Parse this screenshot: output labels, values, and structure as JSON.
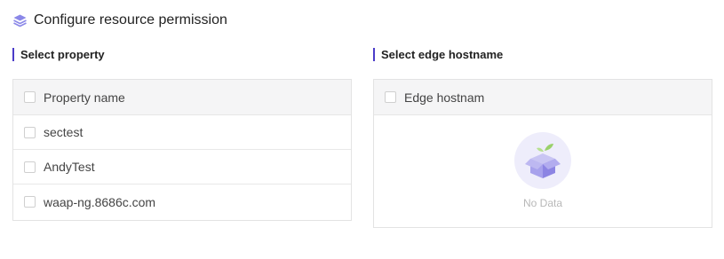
{
  "header": {
    "title": "Configure resource permission",
    "icon": "layers-icon"
  },
  "property_section": {
    "label": "Select property",
    "column_header": "Property name",
    "rows": [
      {
        "name": "sectest"
      },
      {
        "name": "AndyTest"
      },
      {
        "name": "waap-ng.8686c.com"
      }
    ]
  },
  "hostname_section": {
    "label": "Select edge hostname",
    "column_header": "Edge hostnam",
    "empty_text": "No Data"
  },
  "colors": {
    "accent": "#4b3cc9",
    "header_bg": "#f5f5f6",
    "border": "#e3e3e3",
    "muted_text": "#b8b8b8"
  }
}
